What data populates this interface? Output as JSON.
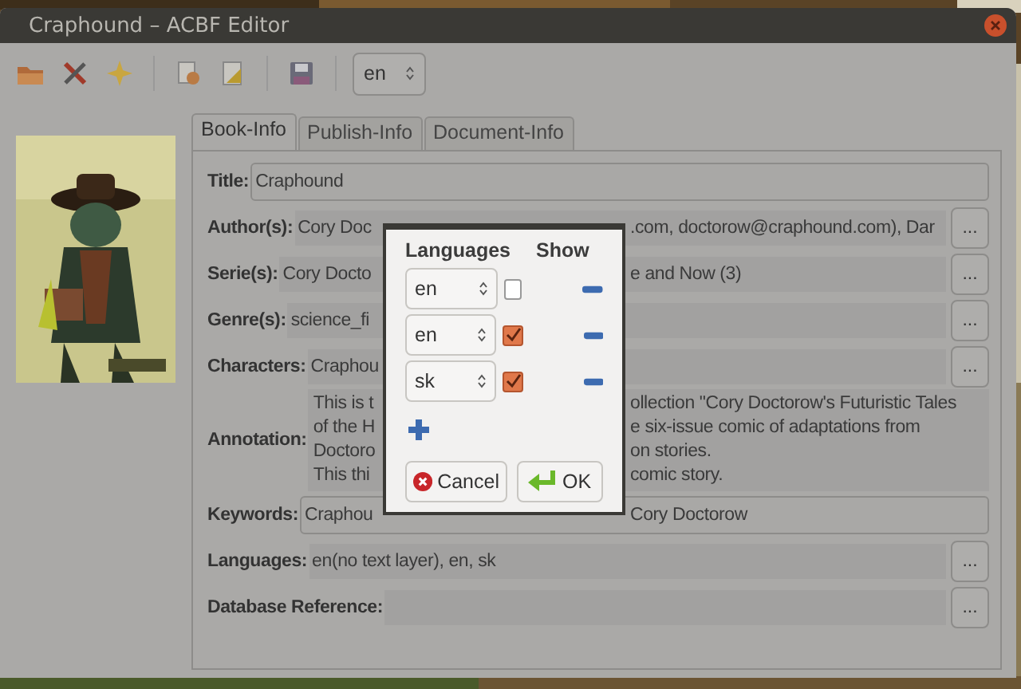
{
  "window": {
    "title": "Craphound – ACBF Editor"
  },
  "toolbar": {
    "language": "en"
  },
  "tabs": [
    {
      "label": "Book-Info",
      "selected": true
    },
    {
      "label": "Publish-Info",
      "selected": false
    },
    {
      "label": "Document-Info",
      "selected": false
    }
  ],
  "fields": [
    {
      "kind": "entry",
      "label": "Title:",
      "fragments": [
        "Craphound"
      ],
      "button": false
    },
    {
      "kind": "text",
      "label": "Author(s):",
      "fragments": [
        "Cory Doc",
        ".com, doctorow@craphound.com), Dar"
      ],
      "button": true,
      "button_label": "..."
    },
    {
      "kind": "text",
      "label": "Serie(s):",
      "fragments": [
        "Cory Docto",
        "e and Now (3)"
      ],
      "button": true,
      "button_label": "..."
    },
    {
      "kind": "text",
      "label": "Genre(s):",
      "fragments": [
        "science_fi"
      ],
      "button": true,
      "button_label": "..."
    },
    {
      "kind": "text",
      "label": "Characters:",
      "fragments": [
        "Craphou"
      ],
      "button": true,
      "button_label": "..."
    },
    {
      "kind": "area",
      "label": "Annotation:",
      "lines": [
        [
          "This is t",
          "ollection \"Cory Doctorow's Futuristic Tales"
        ],
        [
          "of the H",
          "e six-issue comic of adaptations from"
        ],
        [
          "Doctoro",
          "on stories."
        ],
        [
          "This thi",
          "comic story."
        ]
      ],
      "button": false
    },
    {
      "kind": "entry",
      "label": "Keywords:",
      "fragments": [
        "Craphou",
        "Cory Doctorow"
      ],
      "button": false
    },
    {
      "kind": "text",
      "label": "Languages:",
      "fragments": [
        "en(no text layer), en, sk"
      ],
      "button": true,
      "button_label": "..."
    },
    {
      "kind": "text",
      "label": "Database Reference:",
      "button": true,
      "button_label": "..."
    }
  ],
  "dialog": {
    "headers": [
      "Languages",
      "Show"
    ],
    "rows": [
      {
        "language": "en",
        "show": false
      },
      {
        "language": "en",
        "show": true
      },
      {
        "language": "sk",
        "show": true
      }
    ],
    "cancel": "Cancel",
    "ok": "OK"
  }
}
